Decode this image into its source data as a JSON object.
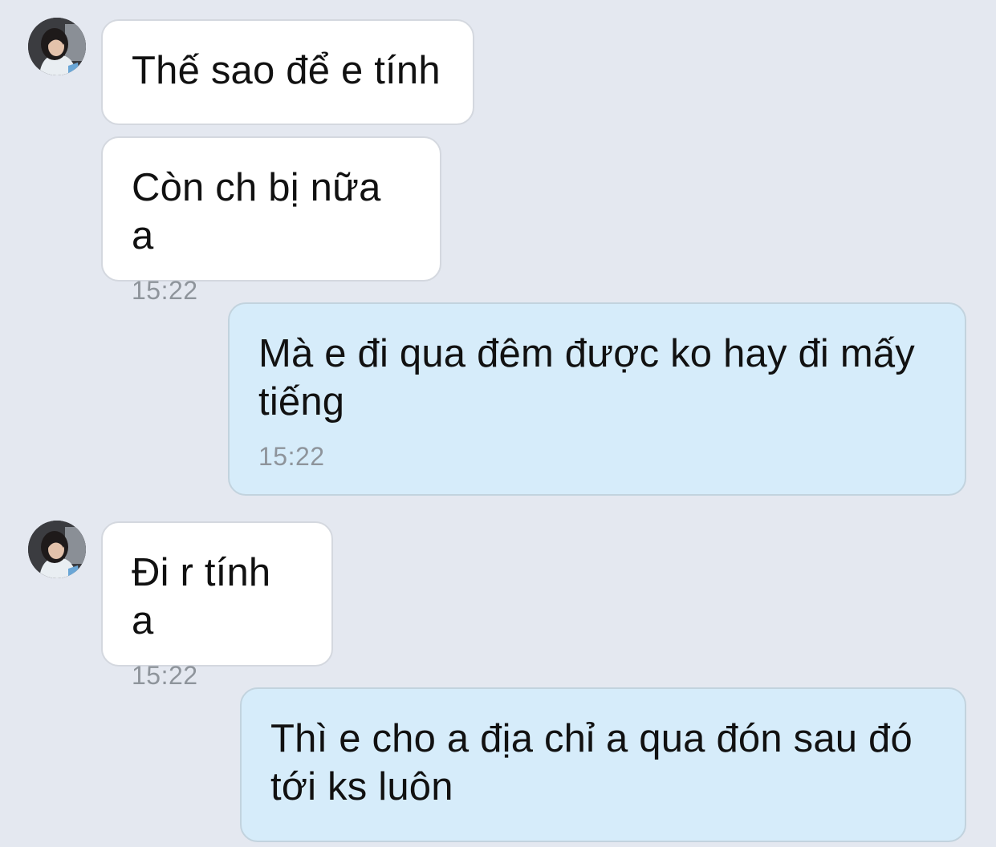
{
  "messages": [
    {
      "sender": "contact",
      "text": "Thế sao để e tính",
      "time": ""
    },
    {
      "sender": "contact",
      "text": "Còn ch bị nữa a",
      "time": "15:22"
    },
    {
      "sender": "me",
      "text": "Mà e đi qua đêm được ko hay đi mấy tiếng",
      "time": "15:22"
    },
    {
      "sender": "contact",
      "text": "Đi r tính a",
      "time": "15:22"
    },
    {
      "sender": "me",
      "text": "Thì e cho a địa chỉ a qua đón sau đó tới ks luôn",
      "time": ""
    }
  ],
  "colors": {
    "background": "#e4e8f0",
    "incoming_bubble": "#ffffff",
    "outgoing_bubble": "#d6ecfa",
    "timestamp": "#8e949b"
  }
}
